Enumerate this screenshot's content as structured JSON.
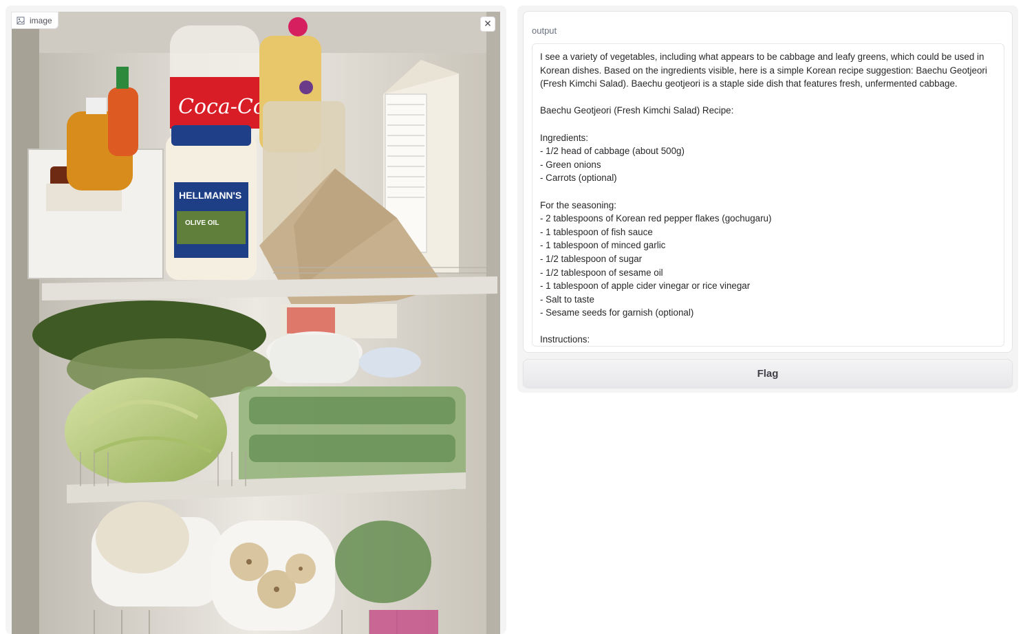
{
  "image_component": {
    "label": "image",
    "clear_icon": "close-icon",
    "label_icon": "image-icon",
    "scene_text": {
      "coke_label": "Coca-Cola",
      "mayo_brand": "HELLMANN'S",
      "mayo_variant": "OLIVE OIL"
    }
  },
  "output_component": {
    "label": "output",
    "text": "I see a variety of vegetables, including what appears to be cabbage and leafy greens, which could be used in Korean dishes. Based on the ingredients visible, here is a simple Korean recipe suggestion: Baechu Geotjeori (Fresh Kimchi Salad). Baechu geotjeori is a staple side dish that features fresh, unfermented cabbage.\n\nBaechu Geotjeori (Fresh Kimchi Salad) Recipe:\n\nIngredients:\n- 1/2 head of cabbage (about 500g)\n- Green onions\n- Carrots (optional)\n\nFor the seasoning:\n- 2 tablespoons of Korean red pepper flakes (gochugaru)\n- 1 tablespoon of fish sauce\n- 1 tablespoon of minced garlic\n- 1/2 tablespoon of sugar\n- 1/2 tablespoon of sesame oil\n- 1 tablespoon of apple cider vinegar or rice vinegar\n- Salt to taste\n- Sesame seeds for garnish (optional)\n\nInstructions:"
  },
  "flag_button": {
    "label": "Flag"
  },
  "colors": {
    "panel_bg": "#f4f4f5",
    "border": "#e4e4e7",
    "text": "#27272a",
    "muted": "#6b7280"
  }
}
